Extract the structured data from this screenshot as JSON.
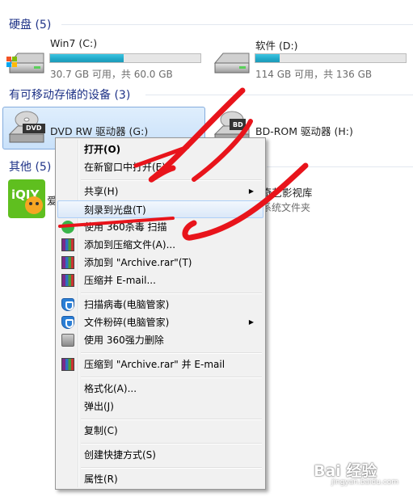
{
  "sections": {
    "hard_disks": "硬盘 (5)",
    "removable": "有可移动存储的设备 (3)",
    "other": "其他 (5)"
  },
  "drives": {
    "c": {
      "name": "Win7 (C:)",
      "info": "30.7 GB 可用，共 60.0 GB",
      "used_fraction": 0.49
    },
    "d": {
      "name": "软件 (D:)",
      "info": "114 GB 可用，共 136 GB",
      "used_fraction": 0.16
    },
    "g": {
      "name": "DVD RW 驱动器 (G:)",
      "icon_label": "DVD"
    },
    "h": {
      "name": "BD-ROM 驱动器 (H:)",
      "icon_label": "BD"
    }
  },
  "other_items": {
    "iqiyi": {
      "name_visible": "爱",
      "right_name": "奇艺影视库",
      "right_sub": "系统文件夹"
    }
  },
  "context_menu": {
    "items": [
      {
        "label": "打开(O)",
        "bold": true
      },
      {
        "label": "在新窗口中打开(E)"
      },
      {
        "label": "共享(H)",
        "submenu": true
      },
      {
        "label": "刻录到光盘(T)",
        "highlighted": true
      },
      {
        "label": "使用 360杀毒 扫描",
        "icon": "360-icon"
      },
      {
        "label": "添加到压缩文件(A)...",
        "icon": "winrar-icon"
      },
      {
        "label": "添加到 \"Archive.rar\"(T)",
        "icon": "winrar-icon"
      },
      {
        "label": "压缩并 E-mail...",
        "icon": "winrar-icon"
      },
      {
        "label": "扫描病毒(电脑管家)",
        "icon": "shield-icon"
      },
      {
        "label": "文件粉碎(电脑管家)",
        "icon": "shield-icon",
        "submenu": true
      },
      {
        "label": "使用 360强力删除",
        "icon": "printer-icon"
      },
      {
        "label": "压缩到 \"Archive.rar\" 并 E-mail",
        "icon": "winrar-icon"
      },
      {
        "label": "格式化(A)..."
      },
      {
        "label": "弹出(J)"
      },
      {
        "label": "复制(C)"
      },
      {
        "label": "创建快捷方式(S)"
      },
      {
        "label": "属性(R)"
      }
    ]
  },
  "annotation_color": "#e8141b",
  "watermark": {
    "text": "Bai 经验",
    "sub": "jingyan.baidu.com"
  }
}
